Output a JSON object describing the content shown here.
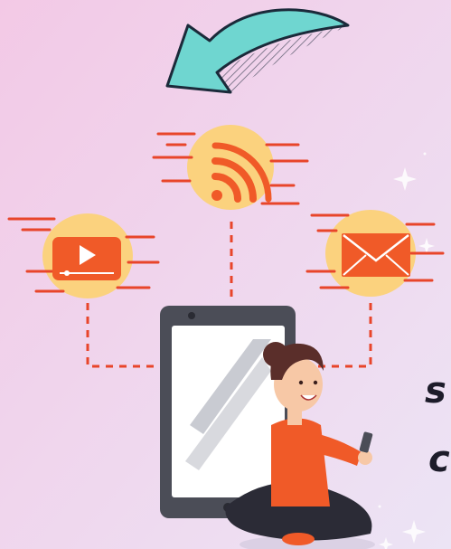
{
  "scene": {
    "colors": {
      "background_top": "#f3c9e6",
      "background_bottom": "#e9e2f5",
      "arrow_fill": "#6fd6d0",
      "arrow_stroke": "#1b2a3a",
      "icon_orange": "#f05a28",
      "blob_yellow": "#fbd27e",
      "connector_red": "#e8452a",
      "tablet_body": "#4b4d57",
      "tablet_screen": "#ffffff",
      "hair": "#5a2e2a",
      "shirt": "#f05a28",
      "pants": "#2b2b36",
      "skin": "#f7c8a6"
    },
    "icons": [
      "rss-icon",
      "youtube-play-icon",
      "mail-icon",
      "curved-arrow-icon"
    ],
    "cropped_text": {
      "line1": "s",
      "line2": "c"
    }
  }
}
